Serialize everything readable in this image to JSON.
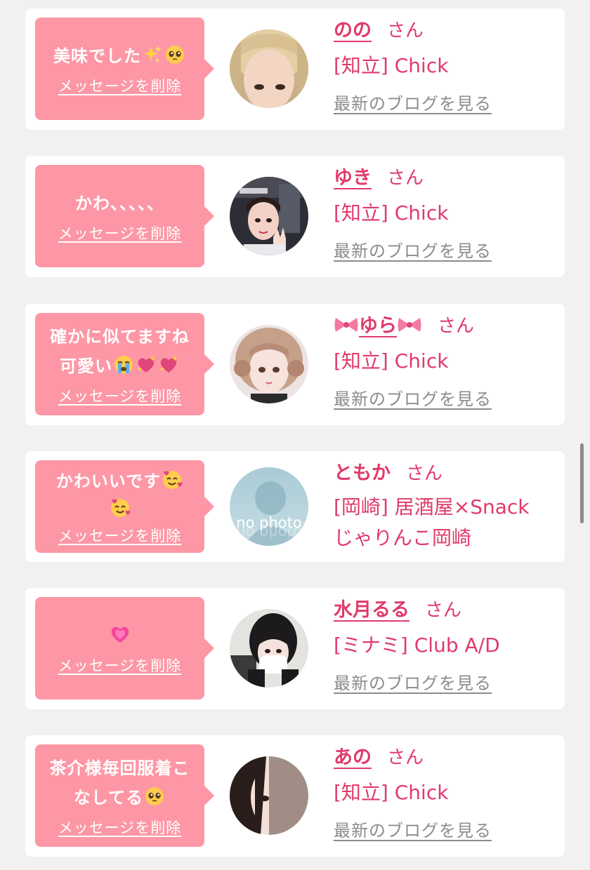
{
  "items": [
    {
      "message": "美味でした",
      "emojis": [
        "sparkles",
        "pleading-face"
      ],
      "delete_label": "メッセージを削除",
      "name": "のの",
      "honorific": "さん",
      "shop": "[知立] Chick",
      "blog_link": "最新のブログを見る",
      "avatar": "blonde-girl-avatar"
    },
    {
      "message": "かわ、、、、、",
      "emojis": [],
      "delete_label": "メッセージを削除",
      "name": "ゆき",
      "honorific": "さん",
      "shop": "[知立] Chick",
      "blog_link": "最新のブログを見る",
      "avatar": "peace-sign-girl-avatar"
    },
    {
      "message_line1": "確かに似てますね",
      "message_line2": "可愛い",
      "emojis": [
        "crying-face",
        "sparkling-heart",
        "sparkling-heart"
      ],
      "delete_label": "メッセージを削除",
      "name": "ゆら",
      "name_decoration": "ribbon",
      "honorific": "さん",
      "shop": "[知立] Chick",
      "blog_link": "最新のブログを見る",
      "avatar": "braided-hair-girl-avatar"
    },
    {
      "message": "かわいいです",
      "emojis": [
        "smiling-face-with-hearts",
        "smiling-face-with-hearts"
      ],
      "delete_label": "メッセージを削除",
      "name": "ともか",
      "honorific": "さん",
      "shop_line1": "[岡崎] 居酒屋×Snack",
      "shop_line2": "じゃりんこ岡崎",
      "avatar": "no-photo-avatar",
      "avatar_text": "no photo"
    },
    {
      "message": "",
      "emojis": [
        "growing-heart"
      ],
      "delete_label": "メッセージを削除",
      "name": "水月るる",
      "honorific": "さん",
      "shop": "[ミナミ] Club A/D",
      "blog_link": "最新のブログを見る",
      "avatar": "masked-girl-avatar"
    },
    {
      "message_line1": "茶介様毎回服着こ",
      "message_line2": "なしてる",
      "emojis": [
        "pleading-face"
      ],
      "delete_label": "メッセージを削除",
      "name": "あの",
      "honorific": "さん",
      "shop": "[知立] Chick",
      "blog_link": "最新のブログを見る",
      "avatar": "half-face-girl-avatar"
    }
  ],
  "colors": {
    "page_bg": "#f1f1f1",
    "bubble": "#fd97a5",
    "accent": "#e03a6b",
    "link_gray": "#8c8c8c"
  }
}
